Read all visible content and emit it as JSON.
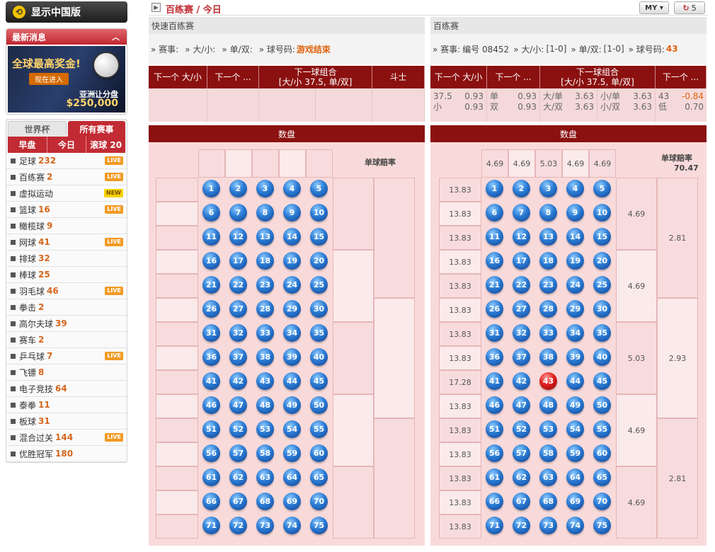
{
  "sidebar": {
    "switch_label": "显示中国版",
    "news_title": "最新消息",
    "banner": {
      "headline": "全球最高奖金!",
      "cta": "现在进入",
      "sub": "亚洲让分盘",
      "amount": "$250,000"
    },
    "sport_tabs": [
      "世界杯",
      "所有赛事"
    ],
    "period_tabs": [
      "早盘",
      "今日",
      "滚球 20"
    ],
    "sports": [
      {
        "name": "足球",
        "count": "232",
        "badge": "LIVE"
      },
      {
        "name": "百练赛",
        "count": "2",
        "badge": "LIVE"
      },
      {
        "name": "虚拟运动",
        "count": "",
        "badge": "NEW"
      },
      {
        "name": "篮球",
        "count": "16",
        "badge": "LIVE"
      },
      {
        "name": "橄榄球",
        "count": "9",
        "badge": ""
      },
      {
        "name": "网球",
        "count": "41",
        "badge": "LIVE"
      },
      {
        "name": "排球",
        "count": "32",
        "badge": ""
      },
      {
        "name": "棒球",
        "count": "25",
        "badge": ""
      },
      {
        "name": "羽毛球",
        "count": "46",
        "badge": "LIVE"
      },
      {
        "name": "拳击",
        "count": "2",
        "badge": ""
      },
      {
        "name": "高尔夫球",
        "count": "39",
        "badge": ""
      },
      {
        "name": "赛车",
        "count": "2",
        "badge": ""
      },
      {
        "name": "乒乓球",
        "count": "7",
        "badge": "LIVE"
      },
      {
        "name": "飞镖",
        "count": "8",
        "badge": ""
      },
      {
        "name": "电子竞技",
        "count": "64",
        "badge": ""
      },
      {
        "name": "泰拳",
        "count": "11",
        "badge": ""
      },
      {
        "name": "板球",
        "count": "31",
        "badge": ""
      },
      {
        "name": "混合过关",
        "count": "144",
        "badge": "LIVE"
      },
      {
        "name": "优胜冠军",
        "count": "180",
        "badge": ""
      }
    ]
  },
  "header": {
    "breadcrumb": "百练赛 / 今日",
    "currency": "MY ▾",
    "refresh_count": "5"
  },
  "panel1": {
    "title": "快速百练赛",
    "info": {
      "event_label": "» 赛事:",
      "event_value": "",
      "ou_label": "» 大/小:",
      "ou_value": "",
      "oe_label": "» 单/双:",
      "oe_value": "",
      "ball_label": "» 球号码:",
      "ball_value": "游戏结束"
    },
    "market_headers": [
      "下一个 大/小",
      "下一个 ...",
      "下一球组合\n[大/小 37.5, 单/双]",
      "斗士"
    ],
    "band": "数盘",
    "odds_label": "单球赔率"
  },
  "panel2": {
    "title": "百练赛",
    "info": {
      "event_label": "» 赛事:",
      "event_value": "编号 08452",
      "ou_label": "» 大/小:",
      "ou_value": "[1-0]",
      "oe_label": "» 单/双:",
      "oe_value": "[1-0]",
      "ball_label": "» 球号码:",
      "ball_value": "43"
    },
    "market_headers": [
      "下一个 大/小",
      "下一个 ...",
      "下一球组合\n[大/小 37.5, 单/双]",
      "下一个 ..."
    ],
    "markets": {
      "ou": [
        {
          "label": "37.5",
          "odds": "0.93"
        },
        {
          "label": "小",
          "odds": "0.93"
        }
      ],
      "oe": [
        {
          "label": "单",
          "odds": "0.93"
        },
        {
          "label": "双",
          "odds": "0.93"
        }
      ],
      "combo_a": [
        {
          "label": "大/单",
          "odds": "3.63"
        },
        {
          "label": "大/双",
          "odds": "3.63"
        }
      ],
      "combo_b": [
        {
          "label": "小/单",
          "odds": "3.63"
        },
        {
          "label": "小/双",
          "odds": "3.63"
        }
      ],
      "last": [
        {
          "label": "43",
          "odds": "-0.84"
        },
        {
          "label": "低",
          "odds": "0.70"
        }
      ]
    },
    "band": "数盘",
    "odds_label": "单球赔率",
    "odds_value": "70.47",
    "column_odds": [
      "4.69",
      "4.69",
      "5.03",
      "4.69",
      "4.69"
    ],
    "row_odds": [
      "13.83",
      "13.83",
      "13.83",
      "13.83",
      "13.83",
      "13.83",
      "13.83",
      "13.83",
      "17.28",
      "13.83",
      "13.83",
      "13.83",
      "13.83",
      "13.83",
      "13.83"
    ],
    "group_odds": [
      "4.69",
      "4.69",
      "5.03",
      "4.69",
      "4.69"
    ],
    "half_odds": [
      "2.81",
      "2.93",
      "2.81"
    ],
    "drawn_ball": 43
  },
  "colors": {
    "brand": "#8b1010",
    "accent": "#c22b33",
    "highlight": "#e0620e",
    "ball": "#2b7bd4",
    "drawn_ball": "#e02020"
  }
}
